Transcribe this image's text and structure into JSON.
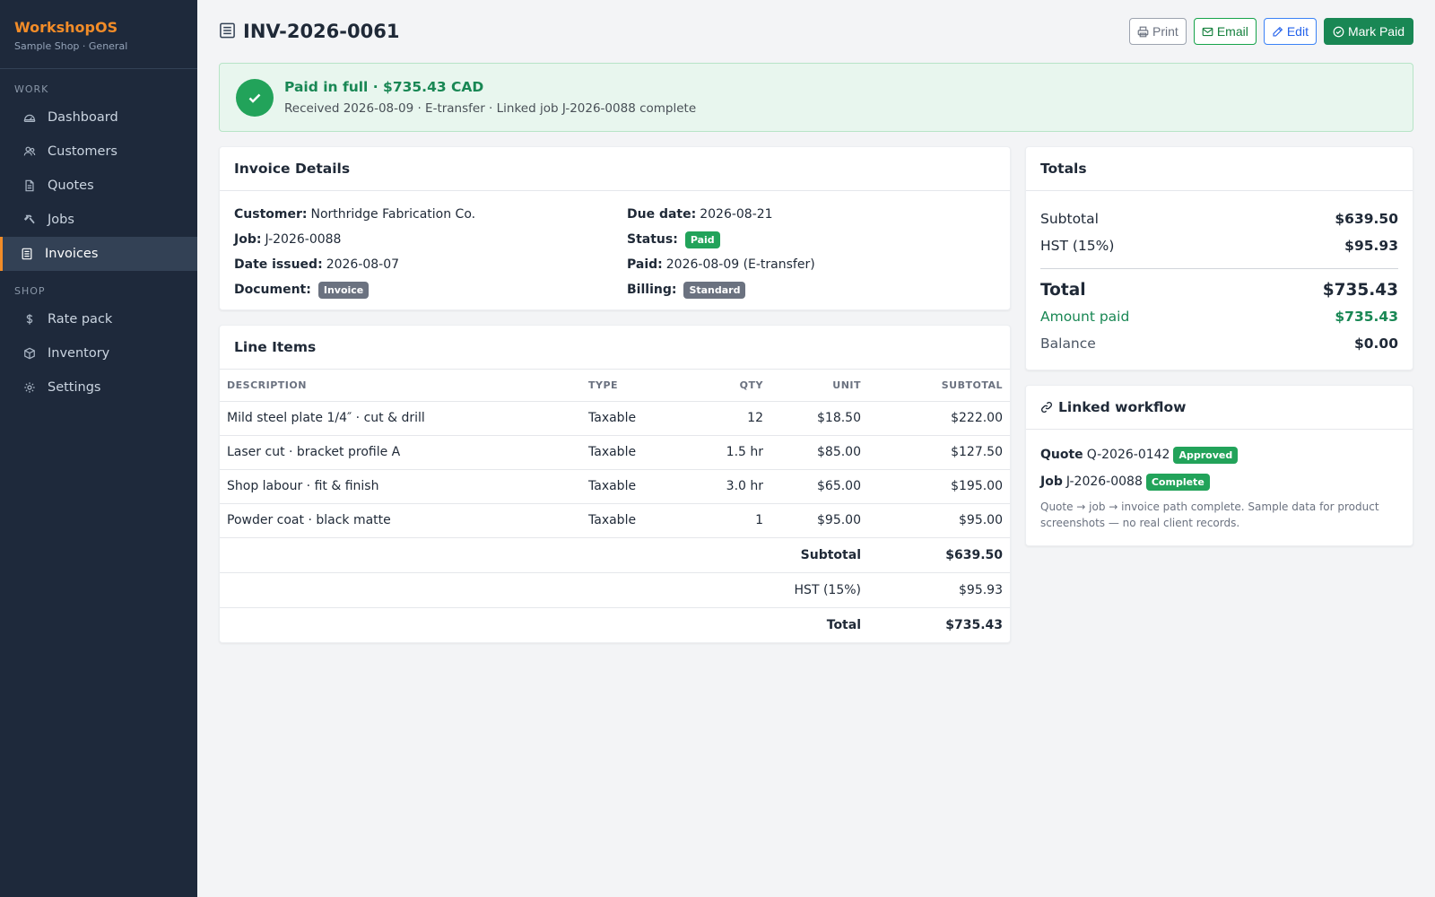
{
  "app": {
    "name": "WorkshopOS",
    "subtitle": "Sample Shop · General"
  },
  "sidebar": {
    "sections": [
      {
        "label": "WORK",
        "items": [
          {
            "label": "Dashboard",
            "icon": "dashboard-icon"
          },
          {
            "label": "Customers",
            "icon": "customers-icon"
          },
          {
            "label": "Quotes",
            "icon": "quotes-icon"
          },
          {
            "label": "Jobs",
            "icon": "hammer-icon"
          },
          {
            "label": "Invoices",
            "icon": "invoice-icon",
            "active": true
          }
        ]
      },
      {
        "label": "SHOP",
        "items": [
          {
            "label": "Rate pack",
            "icon": "dollar-icon"
          },
          {
            "label": "Inventory",
            "icon": "box-icon"
          },
          {
            "label": "Settings",
            "icon": "gear-icon"
          }
        ]
      }
    ]
  },
  "header": {
    "title": "INV-2026-0061",
    "actions": {
      "print": "Print",
      "email": "Email",
      "edit": "Edit",
      "mark_paid": "Mark Paid"
    }
  },
  "banner": {
    "title": "Paid in full · $735.43 CAD",
    "subtitle": "Received 2026-08-09 · E-transfer · Linked job J-2026-0088 complete"
  },
  "details": {
    "heading": "Invoice Details",
    "customer_label": "Customer:",
    "customer": "Northridge Fabrication Co.",
    "job_label": "Job:",
    "job": "J-2026-0088",
    "date_issued_label": "Date issued:",
    "date_issued": "2026-08-07",
    "document_label": "Document:",
    "document": "Invoice",
    "due_date_label": "Due date:",
    "due_date": "2026-08-21",
    "status_label": "Status:",
    "status": "Paid",
    "paid_label": "Paid:",
    "paid": "2026-08-09 (E-transfer)",
    "billing_label": "Billing:",
    "billing": "Standard"
  },
  "line_items": {
    "heading": "Line Items",
    "columns": {
      "description": "DESCRIPTION",
      "type": "TYPE",
      "qty": "QTY",
      "unit": "UNIT",
      "subtotal": "SUBTOTAL"
    },
    "rows": [
      {
        "description": "Mild steel plate 1/4″ · cut & drill",
        "type": "Taxable",
        "qty": "12",
        "unit": "$18.50",
        "subtotal": "$222.00"
      },
      {
        "description": "Laser cut · bracket profile A",
        "type": "Taxable",
        "qty": "1.5 hr",
        "unit": "$85.00",
        "subtotal": "$127.50"
      },
      {
        "description": "Shop labour · fit & finish",
        "type": "Taxable",
        "qty": "3.0 hr",
        "unit": "$65.00",
        "subtotal": "$195.00"
      },
      {
        "description": "Powder coat · black matte",
        "type": "Taxable",
        "qty": "1",
        "unit": "$95.00",
        "subtotal": "$95.00"
      }
    ],
    "subtotal_label": "Subtotal",
    "subtotal": "$639.50",
    "hst_label": "HST (15%)",
    "hst": "$95.93",
    "total_label": "Total",
    "total": "$735.43"
  },
  "totals": {
    "heading": "Totals",
    "subtotal_label": "Subtotal",
    "subtotal": "$639.50",
    "hst_label": "HST (15%)",
    "hst": "$95.93",
    "total_label": "Total",
    "total": "$735.43",
    "amount_paid_label": "Amount paid",
    "amount_paid": "$735.43",
    "balance_label": "Balance",
    "balance": "$0.00"
  },
  "workflow": {
    "heading": "Linked workflow",
    "quote_label": "Quote",
    "quote_id": "Q-2026-0142",
    "quote_status": "Approved",
    "job_label": "Job",
    "job_id": "J-2026-0088",
    "job_status": "Complete",
    "note": "Quote → job → invoice path complete. Sample data for product screenshots — no real client records."
  },
  "colors": {
    "accent": "#f28c28",
    "sidebar_bg": "#1e293b",
    "success": "#198754",
    "badge_green": "#22a35a",
    "badge_gray": "#6b7280"
  }
}
